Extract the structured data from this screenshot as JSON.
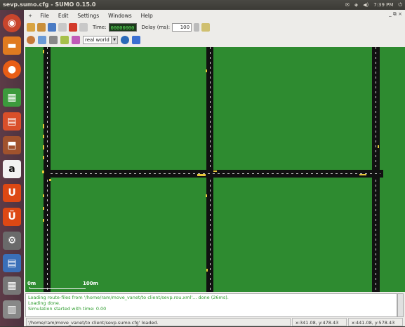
{
  "window": {
    "title": "sevp.sumo.cfg - SUMO 0.15.0"
  },
  "tray": {
    "mail": "✉",
    "wifi": "◈",
    "volume": "◀)",
    "clock": "7:39 PM",
    "power": "⏻"
  },
  "menu": [
    "File",
    "Edit",
    "Settings",
    "Windows",
    "Help"
  ],
  "window_controls": "_ ⧉ ×",
  "toolbar": {
    "time_label": "Time:",
    "time_value": "00000000",
    "delay_label": "Delay (ms):",
    "delay_value": "100"
  },
  "view": {
    "scheme": "real world"
  },
  "map": {
    "scale_start": "0m",
    "scale_end": "100m"
  },
  "log": [
    "Loading route-files from '/home/ram/move_vanet/to client/sevp.rou.xml'... done (26ms).",
    "Loading done.",
    "Simulation started with time: 0.00"
  ],
  "status": {
    "message": "'/home/ram/move_vanet/to client/sevp.sumo.cfg' loaded.",
    "coord_net": "x:341.08, y:478.43",
    "coord_geo": "x:441.08, y:578.43"
  },
  "colors": {
    "map_bg": "#2e8b30",
    "road": "#111111",
    "log_text": "#2a9a2a",
    "launcher": "#5d3b47"
  }
}
